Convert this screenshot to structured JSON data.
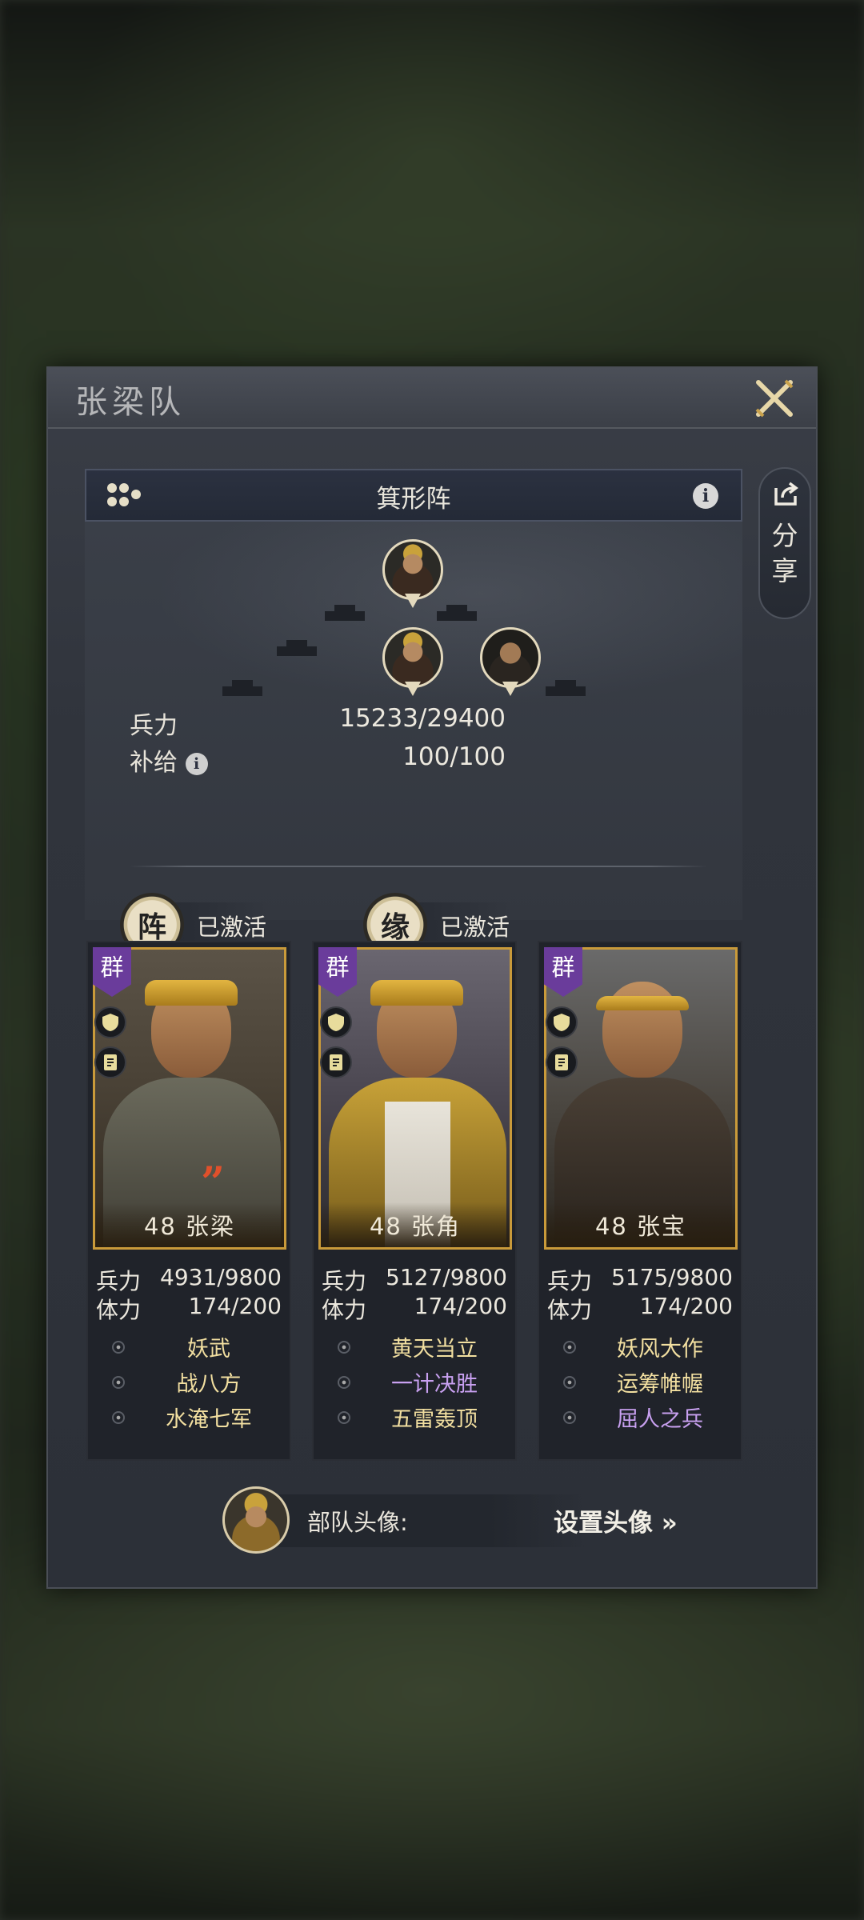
{
  "panel": {
    "title": "张梁队"
  },
  "formation": {
    "name": "箕形阵",
    "troops_label": "兵力",
    "troops_value": "15233/29400",
    "supply_label": "补给",
    "supply_value": "100/100",
    "badges": [
      {
        "glyph": "阵",
        "status": "已激活"
      },
      {
        "glyph": "缘",
        "status": "已激活"
      }
    ]
  },
  "share": {
    "label_line1": "分",
    "label_line2": "享"
  },
  "heroes": [
    {
      "faction": "群",
      "level_name": "48 张梁",
      "troops_label": "兵力",
      "troops": "4931/9800",
      "stamina_label": "体力",
      "stamina": "174/200",
      "skills": [
        {
          "name": "妖武",
          "color": "#f2dfa0"
        },
        {
          "name": "战八方",
          "color": "#f2dfa0"
        },
        {
          "name": "水淹七军",
          "color": "#f2dfa0"
        }
      ],
      "body_color": "#6b6a5c"
    },
    {
      "faction": "群",
      "level_name": "48 张角",
      "troops_label": "兵力",
      "troops": "5127/9800",
      "stamina_label": "体力",
      "stamina": "174/200",
      "skills": [
        {
          "name": "黄天当立",
          "color": "#f2dfa0"
        },
        {
          "name": "一计决胜",
          "color": "#c8a0f0"
        },
        {
          "name": "五雷轰顶",
          "color": "#f2dfa0"
        }
      ],
      "body_color": "#b09030"
    },
    {
      "faction": "群",
      "level_name": "48 张宝",
      "troops_label": "兵力",
      "troops": "5175/9800",
      "stamina_label": "体力",
      "stamina": "174/200",
      "skills": [
        {
          "name": "妖风大作",
          "color": "#f2dfa0"
        },
        {
          "name": "运筹帷幄",
          "color": "#f2dfa0"
        },
        {
          "name": "屈人之兵",
          "color": "#c8a0f0"
        }
      ],
      "body_color": "#4a4036"
    }
  ],
  "avatar_row": {
    "label": "部队头像:",
    "link": "设置头像 »"
  },
  "icons": {
    "close": "close-cross-icon",
    "formation": "formation-dots-icon",
    "info": "info-icon",
    "share": "share-icon",
    "shield": "shield-icon",
    "scroll": "scroll-icon"
  },
  "colors": {
    "accent_gold": "#c99a3a",
    "faction_purple": "#6a3c9b",
    "skill_gold": "#f2dfa0",
    "skill_purple": "#c8a0f0"
  }
}
